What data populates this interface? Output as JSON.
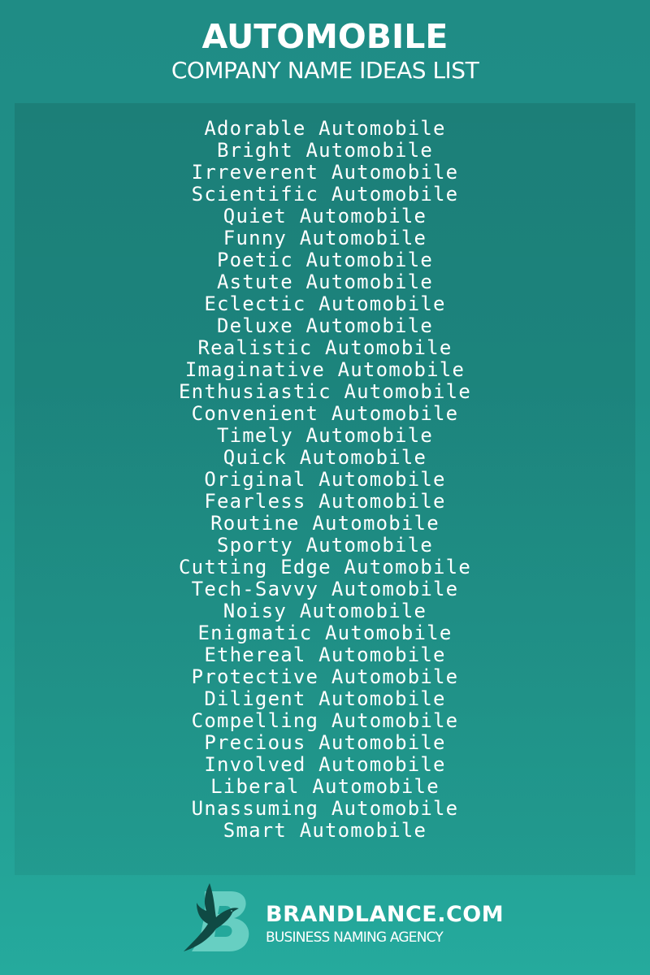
{
  "header": {
    "title": "AUTOMOBILE",
    "subtitle": "COMPANY NAME IDEAS LIST"
  },
  "names": [
    "Adorable Automobile",
    "Bright Automobile",
    "Irreverent Automobile",
    "Scientific Automobile",
    "Quiet Automobile",
    "Funny Automobile",
    "Poetic Automobile",
    "Astute Automobile",
    "Eclectic Automobile",
    "Deluxe Automobile",
    "Realistic Automobile",
    "Imaginative Automobile",
    "Enthusiastic Automobile",
    "Convenient Automobile",
    "Timely Automobile",
    "Quick Automobile",
    "Original Automobile",
    "Fearless Automobile",
    "Routine Automobile",
    "Sporty Automobile",
    "Cutting Edge Automobile",
    "Tech-Savvy Automobile",
    "Noisy Automobile",
    "Enigmatic Automobile",
    "Ethereal Automobile",
    "Protective Automobile",
    "Diligent Automobile",
    "Compelling Automobile",
    "Precious Automobile",
    "Involved Automobile",
    "Liberal Automobile",
    "Unassuming Automobile",
    "Smart Automobile"
  ],
  "footer": {
    "logo_icon": "bird-b-logo-icon",
    "brand": "BRANDLANCE.COM",
    "tagline": "BUSINESS NAMING AGENCY"
  },
  "colors": {
    "background_top": "#1f8c85",
    "background_bottom": "#25aa9d",
    "text": "#ffffff",
    "logo_dark": "#0f4a44",
    "logo_light": "#6fd3c7"
  }
}
